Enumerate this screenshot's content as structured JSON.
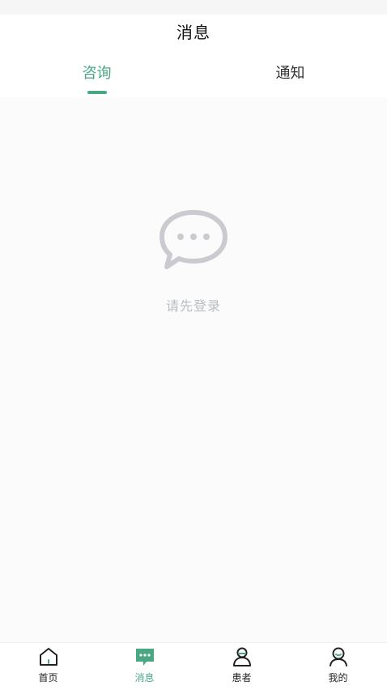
{
  "header": {
    "title": "消息"
  },
  "tabs": [
    {
      "label": "咨询",
      "active": true
    },
    {
      "label": "通知",
      "active": false
    }
  ],
  "empty_state": {
    "icon": "chat-bubble-icon",
    "text": "请先登录"
  },
  "bottom_nav": [
    {
      "label": "首页",
      "icon": "home-icon",
      "active": false
    },
    {
      "label": "消息",
      "icon": "message-icon",
      "active": true
    },
    {
      "label": "患者",
      "icon": "patient-icon",
      "active": false
    },
    {
      "label": "我的",
      "icon": "profile-icon",
      "active": false
    }
  ],
  "colors": {
    "accent": "#4aa783",
    "empty_text": "#b9bdc3",
    "empty_icon": "#c9cbd0",
    "background": "#fbfbfc"
  }
}
